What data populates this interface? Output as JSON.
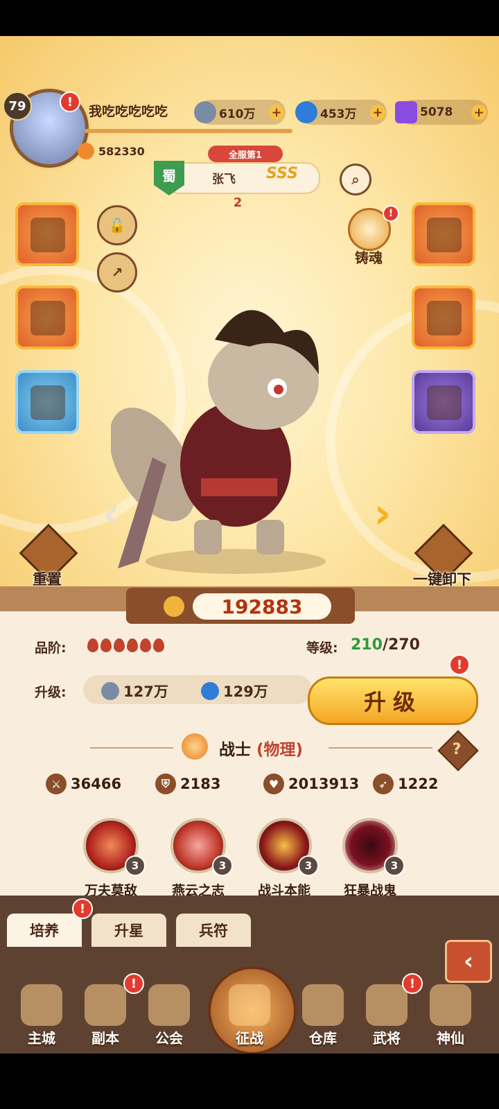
{
  "player": {
    "level": "79",
    "name": "我吃吃吃吃吃",
    "power": "582330"
  },
  "resources": [
    {
      "name": "coin",
      "value": "610万",
      "icon": "coin-icon",
      "color": "#7b8ba3"
    },
    {
      "name": "orb",
      "value": "453万",
      "icon": "blue-orb-icon",
      "color": "#2f7dd8"
    },
    {
      "name": "gem",
      "value": "5078",
      "icon": "purple-gem-icon",
      "color": "#8a4be0"
    }
  ],
  "hero": {
    "rank_tag": "全服第1",
    "faction": "蜀",
    "name": "张飞",
    "grade": "SSS",
    "stars": "2",
    "combat_power": "192883"
  },
  "side_buttons": {
    "soul_label": "铸魂",
    "reset_label": "重置",
    "unequip_label": "一键卸下"
  },
  "stats_panel": {
    "quality_label": "品阶:",
    "quality_pips": 6,
    "level_label": "等级:",
    "level_current": "210",
    "level_max": "/270",
    "upgrade_label": "升级:",
    "cost_coin": "127万",
    "cost_orb": "129万",
    "upgrade_button": "升级"
  },
  "class": {
    "name": "战士",
    "type": "(物理)",
    "help": "?"
  },
  "attributes": [
    {
      "icon": "sword-icon",
      "value": "36466"
    },
    {
      "icon": "shield-icon",
      "value": "2183"
    },
    {
      "icon": "heart-icon",
      "value": "2013913"
    },
    {
      "icon": "boot-icon",
      "value": "1222"
    }
  ],
  "skills": [
    {
      "name": "万夫莫敌",
      "level": "3",
      "color": "#b3261e"
    },
    {
      "name": "燕云之志",
      "level": "3",
      "color": "#c0392b"
    },
    {
      "name": "战斗本能",
      "level": "3",
      "color": "#8e1b1b"
    },
    {
      "name": "狂暴战鬼",
      "level": "3",
      "color": "#7a1020"
    }
  ],
  "tabs": [
    {
      "label": "培养",
      "active": true
    },
    {
      "label": "升星",
      "active": false
    },
    {
      "label": "兵符",
      "active": false
    }
  ],
  "nav": [
    {
      "label": "主城",
      "icon": "city-icon"
    },
    {
      "label": "副本",
      "icon": "sword-cross-icon"
    },
    {
      "label": "公会",
      "icon": "flag-icon"
    },
    {
      "label": "征战",
      "icon": "battle-icon"
    },
    {
      "label": "仓库",
      "icon": "bag-icon"
    },
    {
      "label": "武将",
      "icon": "cat-general-icon"
    },
    {
      "label": "神仙",
      "icon": "cat-immortal-icon"
    }
  ],
  "badge_text": "!"
}
